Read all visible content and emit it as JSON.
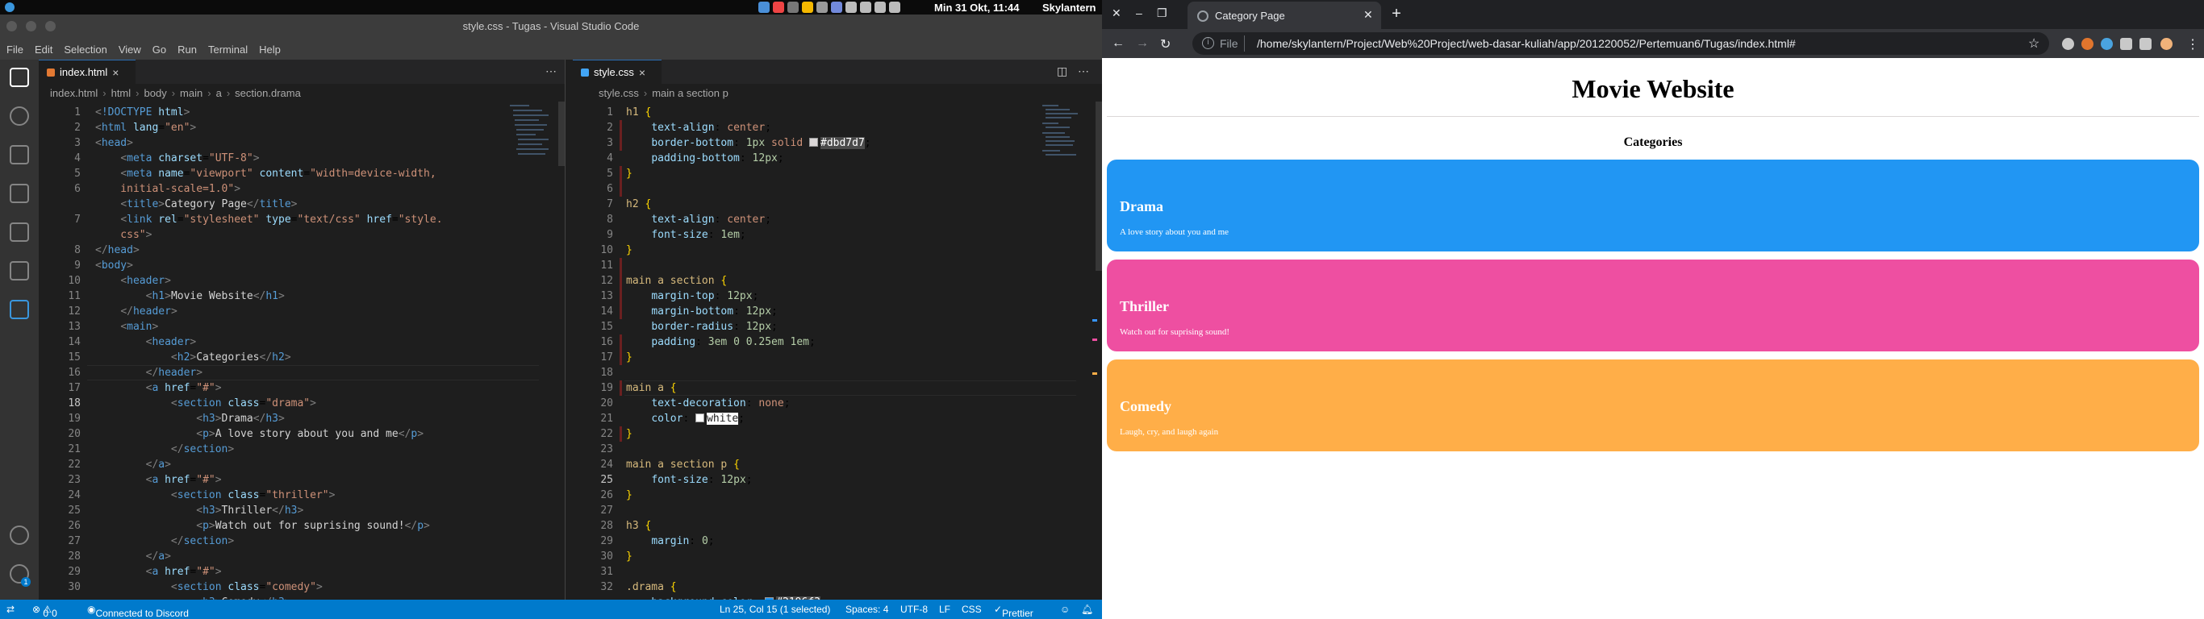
{
  "system": {
    "clock": "Min 31 Okt, 11:44",
    "user": "Skylantern"
  },
  "vscode": {
    "window_title": "style.css - Tugas - Visual Studio Code",
    "menu": [
      "File",
      "Edit",
      "Selection",
      "View",
      "Go",
      "Run",
      "Terminal",
      "Help"
    ],
    "left_pane": {
      "tab_label": "index.html",
      "breadcrumb": [
        "index.html",
        "html",
        "body",
        "main",
        "a",
        "section.drama"
      ]
    },
    "right_pane": {
      "tab_label": "style.css",
      "breadcrumb": [
        "style.css",
        "main a section p"
      ]
    },
    "activity_badge": "1",
    "status": {
      "errors": "0",
      "warnings": "0",
      "discord": "Connected to Discord",
      "position": "Ln 25, Col 15 (1 selected)",
      "spaces": "Spaces: 4",
      "encoding": "UTF-8",
      "eol": "LF",
      "language": "CSS",
      "formatter": "Prettier"
    }
  },
  "chrome": {
    "tab_title": "Category Page",
    "url_scheme": "File",
    "url": "/home/skylantern/Project/Web%20Project/web-dasar-kuliah/app/201220052/Pertemuan6/Tugas/index.html#"
  },
  "page": {
    "title": "Movie Website",
    "subtitle": "Categories",
    "cards": [
      {
        "title": "Drama",
        "desc": "A love story about you and me",
        "color": "#2196f3"
      },
      {
        "title": "Thriller",
        "desc": "Watch out for suprising sound!",
        "color": "#ee4fa1"
      },
      {
        "title": "Comedy",
        "desc": "Laugh, cry, and laugh again",
        "color": "#ffae48"
      }
    ]
  },
  "colors": {
    "vscode_accent": "#007acc",
    "border_color_value": "#dbd7d7",
    "drama_value": "#2196f3"
  }
}
